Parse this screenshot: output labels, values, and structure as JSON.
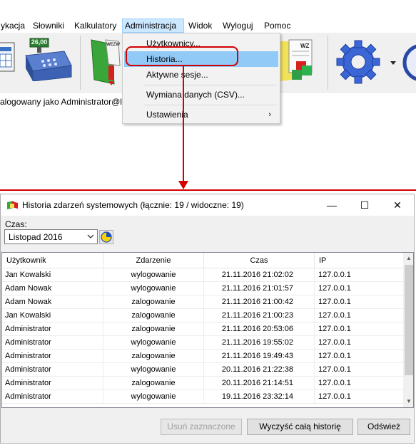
{
  "menubar": {
    "items": [
      "ykacja",
      "Słowniki",
      "Kalkulatory",
      "Administracja",
      "Widok",
      "Wyloguj",
      "Pomoc"
    ],
    "active_index": 3
  },
  "toolbar": {
    "icons": [
      "invoice-icon",
      "cash-register-icon",
      "report-icon",
      "warehouse-doc-icon",
      "settings-gear-icon",
      "globe-icon"
    ],
    "cash_register_display": "26,00",
    "wz_label": "WZ",
    "wezwanie_label": "WEZW"
  },
  "status": {
    "logged_in_text": "alogowany jako Administrator@l"
  },
  "admin_menu": {
    "items": [
      {
        "label": "Użytkownicy...",
        "highlighted": false,
        "submenu": false
      },
      {
        "label": "Historia...",
        "highlighted": true,
        "submenu": false
      },
      {
        "label": "Aktywne sesje...",
        "highlighted": false,
        "submenu": false
      },
      {
        "label": "Wymiana danych (CSV)...",
        "highlighted": false,
        "submenu": false
      },
      {
        "label": "Ustawienia",
        "highlighted": false,
        "submenu": true
      }
    ],
    "submenu_arrow": "›"
  },
  "dialog": {
    "title": "Historia zdarzeń systemowych (łącznie: 19 / widoczne: 19)",
    "minimize": "—",
    "maximize": "☐",
    "close": "✕",
    "time_label": "Czas:",
    "time_value": "Listopad 2016",
    "columns": [
      "Użytkownik",
      "Zdarzenie",
      "Czas",
      "IP"
    ],
    "rows": [
      [
        "Jan Kowalski",
        "wylogowanie",
        "21.11.2016 21:02:02",
        "127.0.0.1"
      ],
      [
        "Adam Nowak",
        "wylogowanie",
        "21.11.2016 21:01:57",
        "127.0.0.1"
      ],
      [
        "Adam Nowak",
        "zalogowanie",
        "21.11.2016 21:00:42",
        "127.0.0.1"
      ],
      [
        "Jan Kowalski",
        "zalogowanie",
        "21.11.2016 21:00:23",
        "127.0.0.1"
      ],
      [
        "Administrator",
        "zalogowanie",
        "21.11.2016 20:53:06",
        "127.0.0.1"
      ],
      [
        "Administrator",
        "wylogowanie",
        "21.11.2016 19:55:02",
        "127.0.0.1"
      ],
      [
        "Administrator",
        "zalogowanie",
        "21.11.2016 19:49:43",
        "127.0.0.1"
      ],
      [
        "Administrator",
        "wylogowanie",
        "20.11.2016 21:22:38",
        "127.0.0.1"
      ],
      [
        "Administrator",
        "zalogowanie",
        "20.11.2016 21:14:51",
        "127.0.0.1"
      ],
      [
        "Administrator",
        "wylogowanie",
        "19.11.2016 23:32:14",
        "127.0.0.1"
      ]
    ],
    "buttons": {
      "delete_selected": "Usuń zaznaczone",
      "clear_history": "Wyczyść całą historię",
      "refresh": "Odśwież"
    }
  },
  "colors": {
    "callout_red": "#d40000",
    "menu_highlight": "#91c9f7",
    "active_menu": "#cce8ff"
  }
}
